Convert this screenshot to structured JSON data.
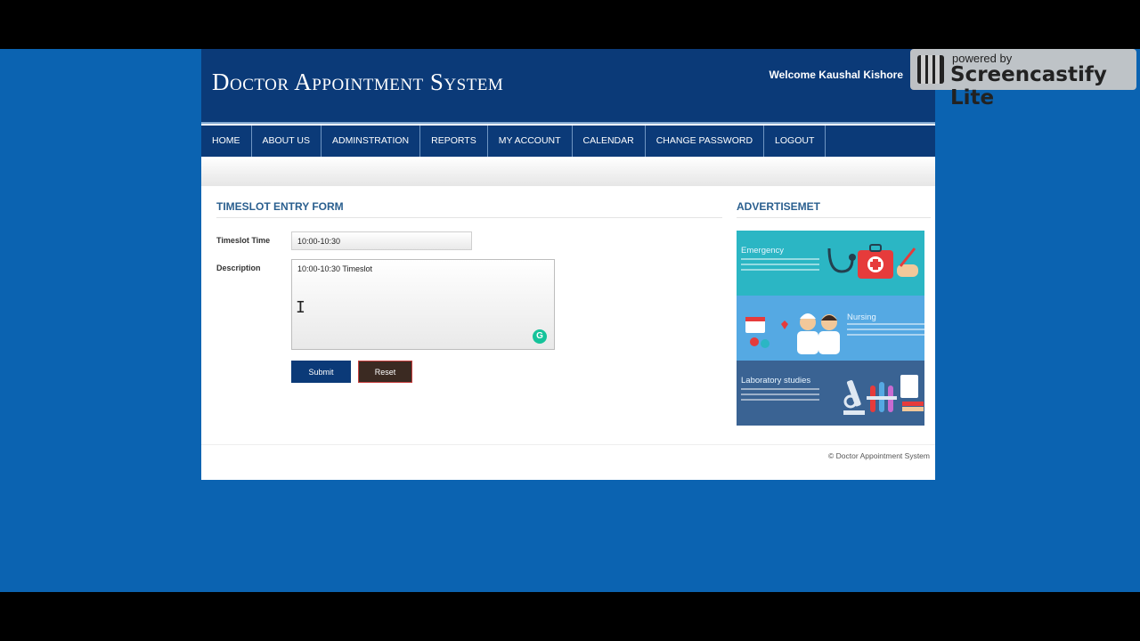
{
  "header": {
    "site_title": "Doctor Appointment System",
    "welcome": "Welcome Kaushal Kishore"
  },
  "nav": {
    "items": [
      "HOME",
      "ABOUT US",
      "ADMINSTRATION",
      "REPORTS",
      "MY ACCOUNT",
      "CALENDAR",
      "CHANGE PASSWORD",
      "LOGOUT"
    ]
  },
  "form": {
    "title": "TIMESLOT ENTRY FORM",
    "time_label": "Timeslot Time",
    "time_value": "10:00-10:30",
    "desc_label": "Description",
    "desc_value": "10:00-10:30 Timeslot",
    "submit_label": "Submit",
    "reset_label": "Reset"
  },
  "ads": {
    "title": "ADVERTISEMET",
    "panels": [
      {
        "heading": "Emergency",
        "color": "#2bb6c4"
      },
      {
        "heading": "Nursing",
        "color": "#55a9e3"
      },
      {
        "heading": "Laboratory studies",
        "color": "#3a6393"
      }
    ]
  },
  "footer": {
    "text": "© Doctor Appointment System"
  },
  "overlay": {
    "powered_by": "powered by",
    "brand": "Screencastify Lite"
  },
  "colors": {
    "page_bg": "#0b63b1",
    "header_bg": "#0b3a78",
    "heading_text": "#2a5f8f",
    "reset_border": "#c83f3f"
  }
}
